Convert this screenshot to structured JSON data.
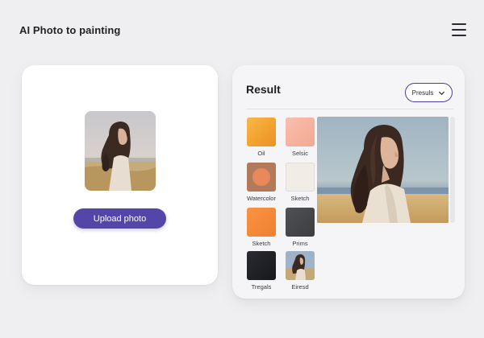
{
  "header": {
    "title": "AI Photo to painting",
    "menu_icon": "hamburger-menu-icon"
  },
  "upload": {
    "button_label": "Upload photo"
  },
  "result": {
    "title": "Result",
    "presets_label": "Presuls",
    "presets_icon": "chevron-down-icon",
    "styles": [
      {
        "label": "Oil",
        "color": "#f3a63a"
      },
      {
        "label": "Selsic",
        "color": "#f6b3a2"
      },
      {
        "label": "Watercolor",
        "color": "#b07858"
      },
      {
        "label": "Sketch",
        "color": "#efe9e2"
      },
      {
        "label": "Sketch",
        "color": "#f4893a"
      },
      {
        "label": "Prims",
        "color": "#46474a"
      },
      {
        "label": "Tregals",
        "color": "#1f2024"
      },
      {
        "label": "Eiresd",
        "color": "#8ea3bf"
      }
    ]
  },
  "colors": {
    "accent": "#5346a8",
    "background": "#efeff1"
  }
}
